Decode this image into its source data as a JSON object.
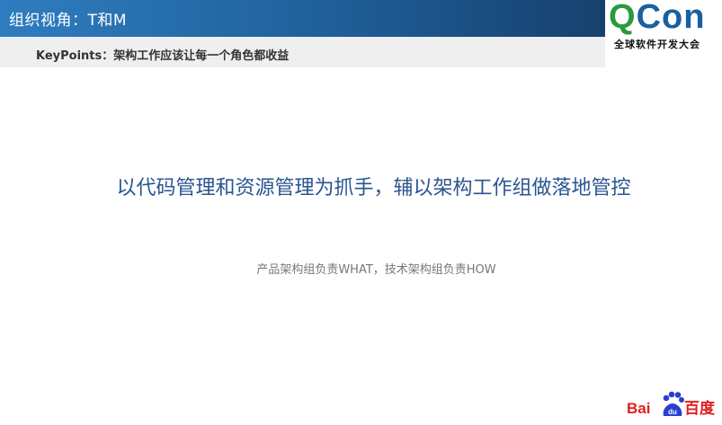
{
  "header": {
    "title": "组织视角：T和M",
    "keypoints": "KeyPoints：架构工作应该让每一个角色都收益"
  },
  "logo": {
    "qcon_q": "Q",
    "qcon_con": "Con",
    "qcon_subtitle": "全球软件开发大会"
  },
  "main": {
    "headline": "以代码管理和资源管理为抓手，辅以架构工作组做落地管控",
    "subline": "产品架构组负责WHAT，技术架构组负责HOW"
  },
  "footer": {
    "baidu_left": "Bai",
    "baidu_paw": "du",
    "baidu_right": "百度"
  }
}
